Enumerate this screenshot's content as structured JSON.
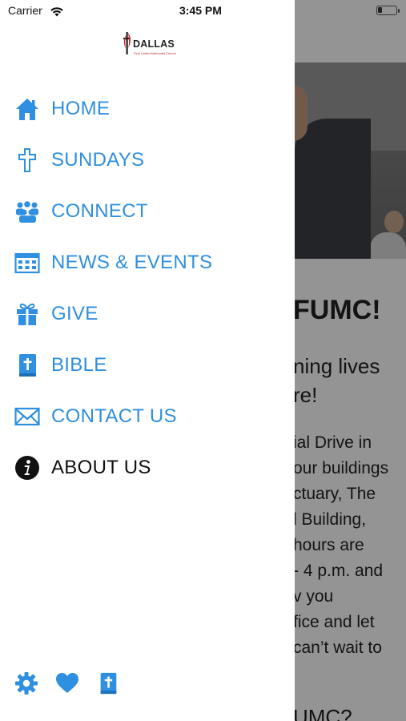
{
  "status_bar": {
    "carrier": "Carrier",
    "time": "3:45 PM"
  },
  "drawer": {
    "logo": {
      "name": "DALLAS",
      "subtitle": "First United Methodist Church"
    },
    "menu": [
      {
        "label": "HOME",
        "icon": "home-icon"
      },
      {
        "label": "SUNDAYS",
        "icon": "cross-icon"
      },
      {
        "label": "CONNECT",
        "icon": "group-icon"
      },
      {
        "label": "NEWS & EVENTS",
        "icon": "calendar-icon"
      },
      {
        "label": "GIVE",
        "icon": "gift-icon"
      },
      {
        "label": "BIBLE",
        "icon": "bible-icon"
      },
      {
        "label": "CONTACT US",
        "icon": "mail-icon"
      },
      {
        "label": "ABOUT US",
        "icon": "info-icon"
      }
    ],
    "footer_icons": [
      "settings-icon",
      "heart-icon",
      "bible-icon"
    ]
  },
  "background": {
    "heading": "FUMC!",
    "subheading_lines": [
      "ning lives",
      "re!"
    ],
    "paragraph_lines": [
      "ial Drive in",
      "our buildings",
      "ctuary, The",
      "l Building,",
      "hours are",
      "- 4 p.m. and",
      "v you",
      "fice and let",
      "can’t wait to"
    ],
    "bottom_heading": "UMC?"
  },
  "colors": {
    "accent": "#2f8fe0",
    "logo_red": "#c0272d",
    "scrim": "rgba(0,0,0,0.42)"
  }
}
